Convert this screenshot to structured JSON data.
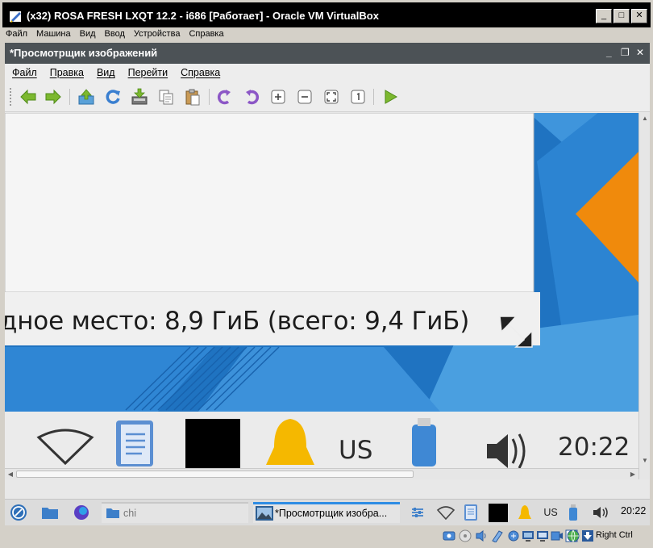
{
  "vbox": {
    "title": "(x32) ROSA FRESH LXQT 12.2 - i686 [Работает] - Oracle VM VirtualBox",
    "menu": [
      "Файл",
      "Машина",
      "Вид",
      "Ввод",
      "Устройства",
      "Справка"
    ],
    "host_key": "Right Ctrl"
  },
  "viewer": {
    "title": "*Просмотрщик изображений",
    "window_controls": {
      "minimize": "_",
      "maximize": "❐",
      "close": "✕"
    },
    "menu": [
      "Файл",
      "Правка",
      "Вид",
      "Перейти",
      "Справка"
    ],
    "toolbar_icons": [
      "go-previous-icon",
      "go-next-icon",
      "open-icon",
      "reload-icon",
      "save-icon",
      "copy-icon",
      "paste-icon",
      "rotate-cw-icon",
      "rotate-ccw-icon",
      "zoom-in-icon",
      "zoom-out-icon",
      "zoom-fit-icon",
      "zoom-original-icon",
      "slideshow-icon"
    ]
  },
  "image_content": {
    "disk_text": "дное место: 8,9 ГиБ (всего: 9,4 ГиБ)",
    "layout_indicator": "US",
    "clock": "20:22"
  },
  "panel": {
    "tasks": [
      {
        "label": "chi",
        "active": false
      },
      {
        "label": "*Просмотрщик изобра...",
        "active": true
      }
    ],
    "layout_indicator": "US",
    "clock": "20:22"
  },
  "colors": {
    "accent": "#2e8de4",
    "image_blue": "#1f73c1",
    "image_orange": "#f08a0c",
    "notification_yellow": "#f5b800",
    "titlebar": "#4c5256"
  }
}
